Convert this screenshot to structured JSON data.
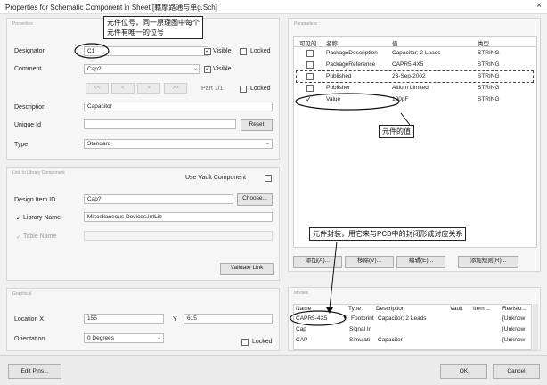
{
  "window": {
    "title": "Properties for Schematic Component in Sheet [籍摩路通与单g.Sch]",
    "close": "×"
  },
  "props_panel": {
    "header": "Properties",
    "designator_label": "Designator",
    "designator_value": "C1",
    "visible1": "Visible",
    "locked1": "Locked",
    "comment_label": "Comment",
    "comment_value": "Cap?",
    "visible2": "Visible",
    "nav_buttons": [
      "<<",
      "<",
      ">",
      ">>"
    ],
    "part": "Part 1/1",
    "locked2": "Locked",
    "description_label": "Description",
    "description_value": "Capacitor",
    "unique_label": "Unique Id",
    "unique_value": "",
    "reset": "Reset",
    "type_label": "Type",
    "type_value": "Standard"
  },
  "link_panel": {
    "header": "Link to Library Component",
    "use_vault": "Use Vault Component",
    "design_item_label": "Design Item ID",
    "design_item_value": "Cap?",
    "choose": "Choose...",
    "library_name_label": "Library Name",
    "library_name_value": "Miscellaneous Devices.IntLib",
    "table_name_label": "Table Name",
    "validate": "Validate Link"
  },
  "graphical_panel": {
    "header": "Graphical",
    "location_label": "Location X",
    "x_value": "155",
    "y_label": "Y",
    "y_value": "615",
    "orientation_label": "Orientation",
    "orientation_value": "0 Degrees",
    "locked": "Locked"
  },
  "parameters_panel": {
    "header": "Parameters",
    "columns": [
      "可见的",
      "名称",
      "值",
      "类型"
    ],
    "rows": [
      {
        "visible": "",
        "name": "PackageDescription",
        "value": "Capacitor; 2 Leads",
        "type": "STRING"
      },
      {
        "visible": "",
        "name": "PackageReference",
        "value": "CAPR5-4X5",
        "type": "STRING"
      },
      {
        "visible": "",
        "name": "Published",
        "value": "23-Sep-2002",
        "type": "STRING"
      },
      {
        "visible": "",
        "name": "Publisher",
        "value": "Altium Limited",
        "type": "STRING"
      },
      {
        "visible": "✓",
        "name": "Value",
        "value": "100pF",
        "type": "STRING"
      }
    ],
    "buttons": [
      "添加(A)...",
      "移除(V)...",
      "编辑(E)...",
      "添加规则(R)..."
    ]
  },
  "models_panel": {
    "header": "Models",
    "columns": [
      "Name",
      "Type",
      "Description",
      "Vault",
      "Item ...",
      "Revisio..."
    ],
    "rows": [
      {
        "name": "CAPR5-4X5",
        "type": "Footprint",
        "description": "Capacitor; 2 Leads",
        "vault": "",
        "item": "",
        "revision": "[Unknow"
      },
      {
        "name": "Cap",
        "type": "Signal Ir",
        "description": "",
        "vault": "",
        "item": "",
        "revision": "[Unknow"
      },
      {
        "name": "CAP",
        "type": "Simulati",
        "description": "Capacitor",
        "vault": "",
        "item": "",
        "revision": "[Unknow"
      }
    ]
  },
  "footer": {
    "edit_pins": "Edit Pins...",
    "ok": "OK",
    "cancel": "Cancel"
  },
  "annotations": {
    "designator": [
      "元件位号，同一原理图中每个",
      "元件有唯一的位号"
    ],
    "value": "元件的值",
    "footprint": "元件封装，用它来与PCB中的封闭形成对应关系"
  }
}
